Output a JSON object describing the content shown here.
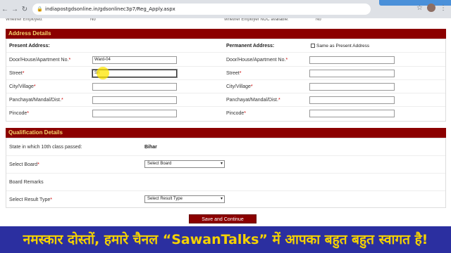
{
  "browser": {
    "url": "indiapostgdsonline.in/gdsonlinec3p7/Reg_Apply.aspx"
  },
  "prev_row": {
    "left": "Whether Employed:",
    "left_value": "No",
    "right": "Whether Employer NOC available:",
    "right_value": "No"
  },
  "address": {
    "title": "Address Details",
    "present_label": "Present Address:",
    "permanent_label": "Permanent Address:",
    "same_as_label": "Same as Present Address",
    "fields": [
      {
        "label": "Door/House/Apartment No.",
        "value": "Ward-04",
        "perm_label": "Door/House/Apartment No."
      },
      {
        "label": "Street",
        "value": "Sri",
        "perm_label": "Street"
      },
      {
        "label": "City/Village",
        "value": "",
        "perm_label": "City/Village"
      },
      {
        "label": "Panchayat/Mandal/Dist.",
        "value": "",
        "perm_label": "Panchayat/Mandal/Dist."
      },
      {
        "label": "Pincode",
        "value": "",
        "perm_label": "Pincode"
      }
    ],
    "required_mark": "*"
  },
  "qualification": {
    "title": "Qualification Details",
    "state_label": "State in which 10th class passed:",
    "state_value": "Bihar",
    "board_label": "Select Board",
    "board_value": "Select Board",
    "remarks_label": "Board Remarks",
    "result_label": "Select Result Type",
    "result_value": "Select Result Type"
  },
  "actions": {
    "save_label": "Save and Continue"
  },
  "banner": {
    "text": "नमस्कार दोस्तों, हमारे चैनल “SawanTalks” में आपका बहुत बहुत स्वागत है!"
  },
  "colors": {
    "header_bg": "#8b0000",
    "header_text": "#f5d76e",
    "banner_bg": "#2b2fa0",
    "banner_text": "#f5d200"
  }
}
